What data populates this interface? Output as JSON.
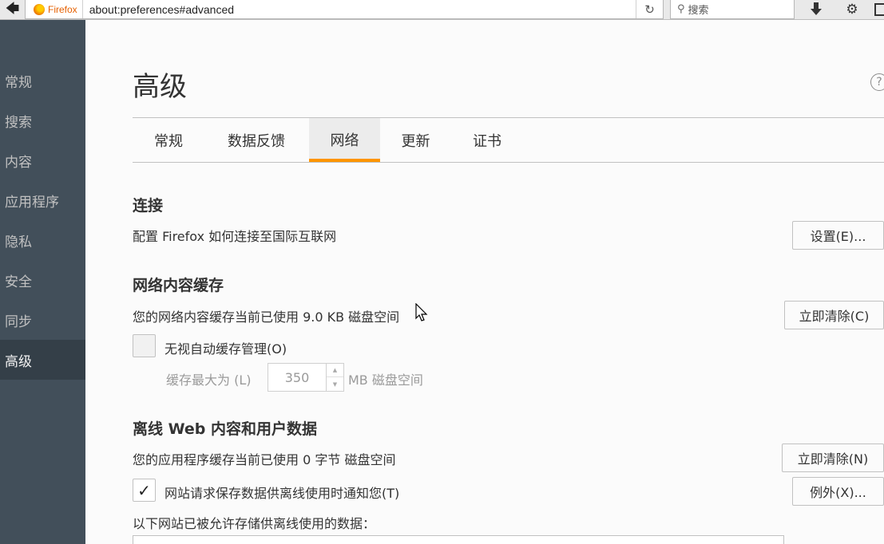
{
  "toolbar": {
    "identity_label": "Firefox",
    "url": "about:preferences#advanced",
    "search_placeholder": "搜索",
    "icons": [
      "back-arrow-icon",
      "firefox-logo-icon",
      "reload-icon",
      "search-icon",
      "download-icon",
      "gear-icon",
      "library-icon"
    ]
  },
  "sidebar": {
    "items": [
      {
        "label": "常规"
      },
      {
        "label": "搜索"
      },
      {
        "label": "内容"
      },
      {
        "label": "应用程序"
      },
      {
        "label": "隐私"
      },
      {
        "label": "安全"
      },
      {
        "label": "同步"
      },
      {
        "label": "高级",
        "selected": true
      }
    ]
  },
  "main": {
    "title": "高级",
    "tabs": [
      {
        "label": "常规"
      },
      {
        "label": "数据反馈"
      },
      {
        "label": "网络",
        "selected": true
      },
      {
        "label": "更新"
      },
      {
        "label": "证书"
      }
    ],
    "connection": {
      "heading": "连接",
      "desc": "配置 Firefox 如何连接至国际互联网",
      "button": "设置(E)..."
    },
    "cache": {
      "heading": "网络内容缓存",
      "desc": "您的网络内容缓存当前已使用 9.0 KB 磁盘空间",
      "button": "立即清除(C)",
      "override_label": "无视自动缓存管理(O)",
      "override_checked": false,
      "limit_label": "缓存最大为 (L)",
      "limit_value": "350",
      "limit_unit": "MB 磁盘空间"
    },
    "offline": {
      "heading": "离线 Web 内容和用户数据",
      "desc": "您的应用程序缓存当前已使用 0 字节 磁盘空间",
      "button": "立即清除(N)",
      "notify_label": "网站请求保存数据供离线使用时通知您(T)",
      "notify_checked": true,
      "exceptions_button": "例外(X)...",
      "list_label": "以下网站已被允许存储供离线使用的数据："
    }
  },
  "colors": {
    "sidebar_bg": "#424f5a",
    "sidebar_selected_bg": "#343f48",
    "accent": "#ff9500"
  }
}
